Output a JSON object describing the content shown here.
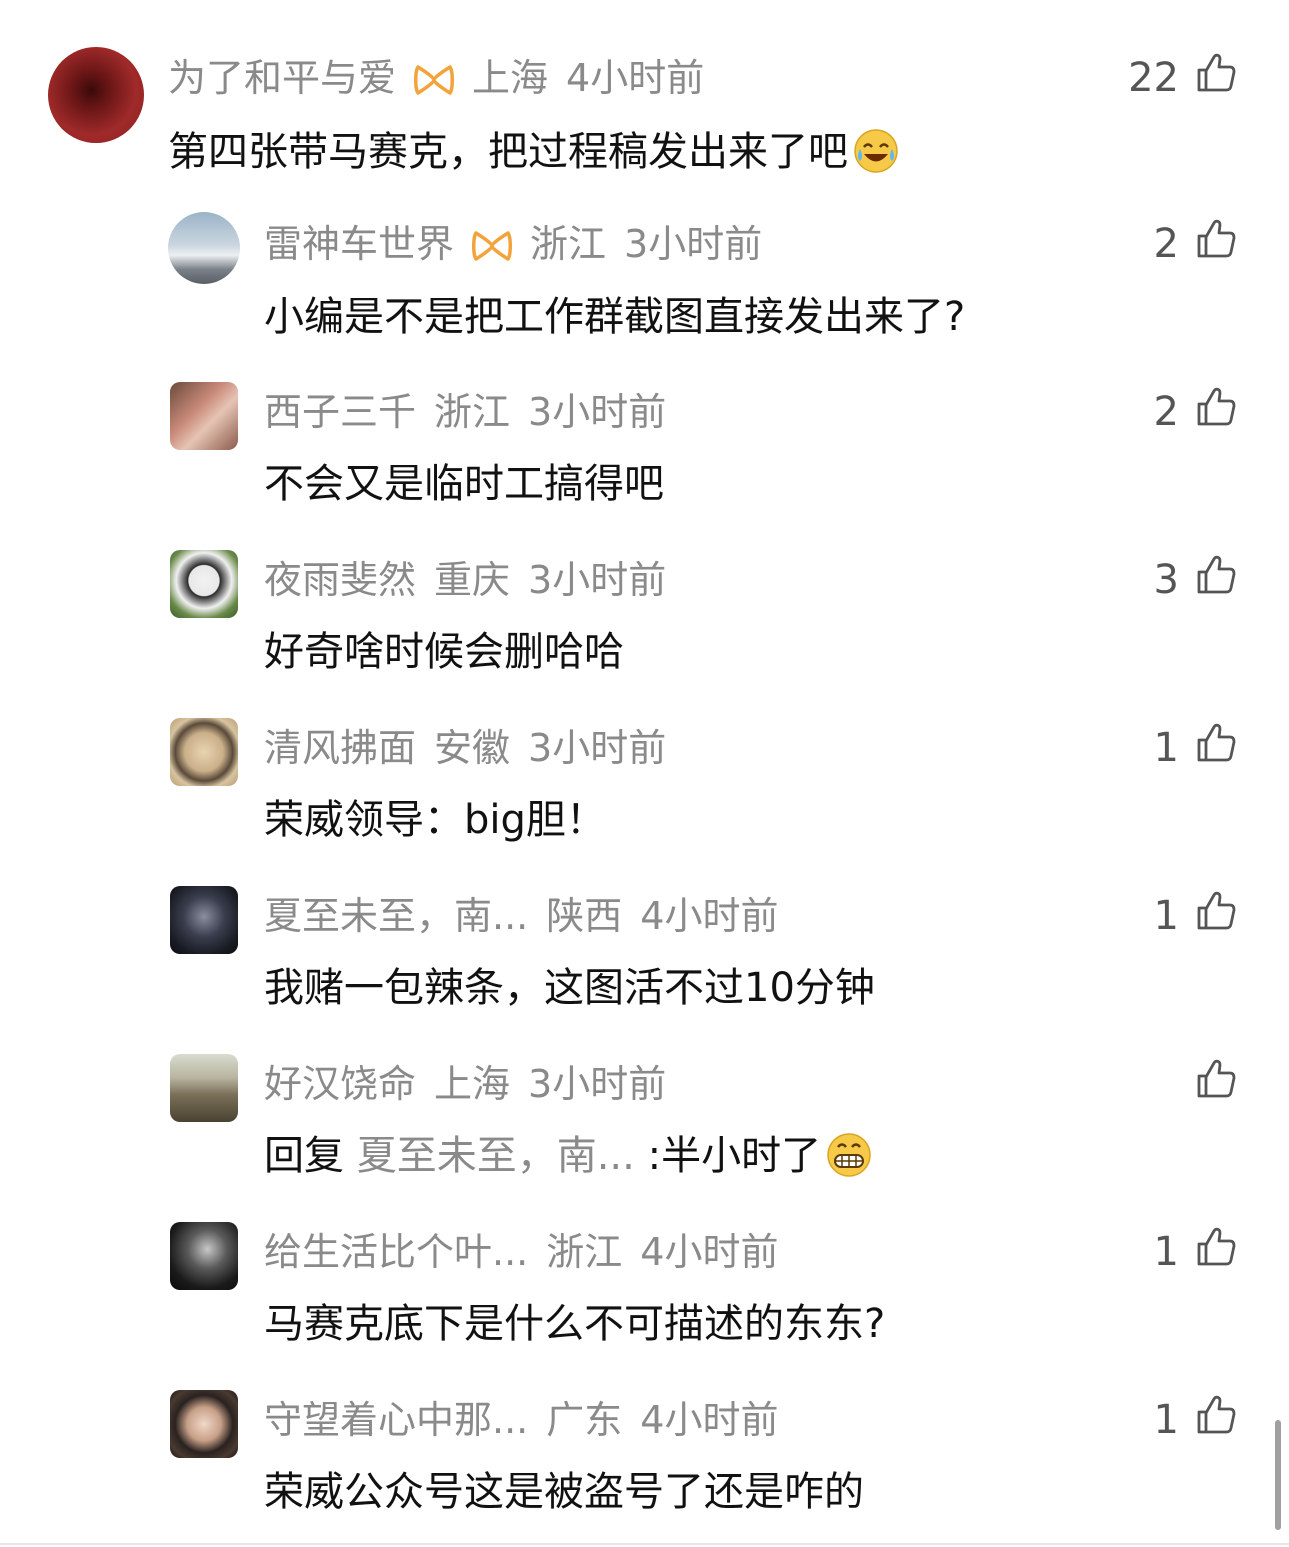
{
  "comments": [
    {
      "user": "为了和平与爱",
      "badge": "bow-badge",
      "location": "上海",
      "time": "4小时前",
      "likes": "22",
      "text": "第四张带马赛克，把过程稿发出来了吧",
      "emoji": "laughing-crying-emoji"
    },
    {
      "user": "雷神车世界",
      "badge": "bow-badge",
      "location": "浙江",
      "time": "3小时前",
      "likes": "2",
      "text": "小编是不是把工作群截图直接发出来了?"
    },
    {
      "user": "西子三千",
      "location": "浙江",
      "time": "3小时前",
      "likes": "2",
      "text": "不会又是临时工搞得吧"
    },
    {
      "user": "夜雨斐然",
      "location": "重庆",
      "time": "3小时前",
      "likes": "3",
      "text": "好奇啥时候会删哈哈"
    },
    {
      "user": "清风拂面",
      "location": "安徽",
      "time": "3小时前",
      "likes": "1",
      "text": "荣威领导：big胆！"
    },
    {
      "user": "夏至未至，南...",
      "location": "陕西",
      "time": "4小时前",
      "likes": "1",
      "text": "我赌一包辣条，这图活不过10分钟"
    },
    {
      "user": "好汉饶命",
      "location": "上海",
      "time": "3小时前",
      "likes": "",
      "reply_prefix": "回复",
      "reply_to": "夏至未至，南...",
      "text": ":半小时了",
      "emoji": "grinning-emoji"
    },
    {
      "user": "给生活比个叶...",
      "location": "浙江",
      "time": "4小时前",
      "likes": "1",
      "text": "马赛克底下是什么不可描述的东东?"
    },
    {
      "user": "守望着心中那...",
      "location": "广东",
      "time": "4小时前",
      "likes": "1",
      "text": "荣威公众号这是被盗号了还是咋的"
    }
  ],
  "icons": {
    "like": "thumbs-up-icon"
  }
}
